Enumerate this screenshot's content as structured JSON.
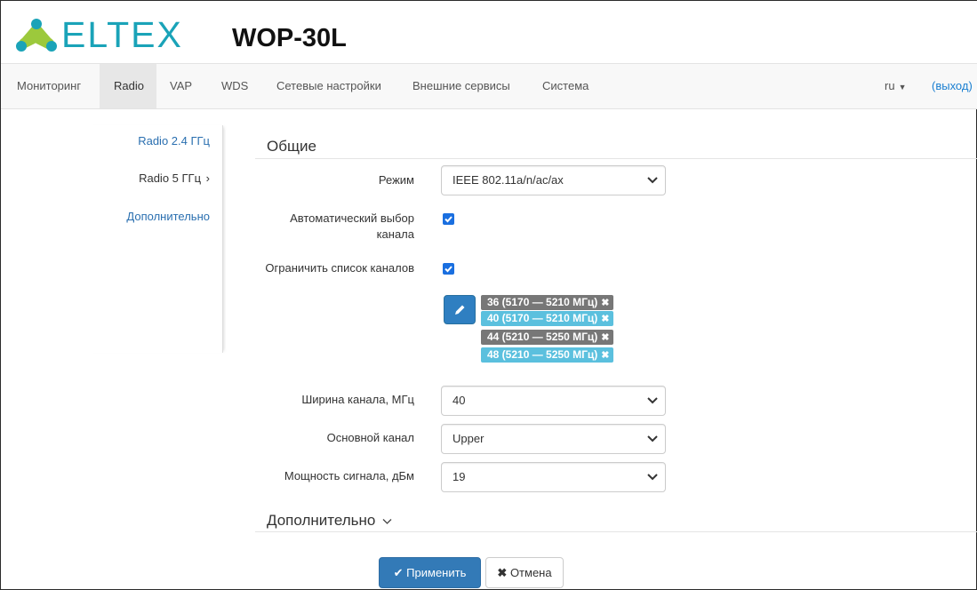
{
  "header": {
    "logo_text": "ELTEX",
    "model": "WOP-30L",
    "colors": {
      "logo": "#1aa3b8",
      "accent": "#337ab7"
    }
  },
  "nav": {
    "items": [
      {
        "label": "Мониторинг"
      },
      {
        "label": "Radio",
        "active": true
      },
      {
        "label": "VAP"
      },
      {
        "label": "WDS"
      },
      {
        "label": "Сетевые настройки"
      },
      {
        "label": "Внешние сервисы"
      },
      {
        "label": "Система"
      }
    ],
    "lang": "ru",
    "logout": "(выход)"
  },
  "sidebar": {
    "items": [
      {
        "label": "Radio 2.4 ГГц"
      },
      {
        "label": "Radio 5 ГГц",
        "active": true,
        "icon": "chevron-right-icon"
      },
      {
        "label": "Дополнительно"
      }
    ]
  },
  "general": {
    "title": "Общие",
    "mode": {
      "label": "Режим",
      "value": "IEEE 802.11a/n/ac/ax"
    },
    "auto_channel": {
      "label_line1": "Автоматический выбор",
      "label_line2": "канала",
      "checked": true
    },
    "limit_channels": {
      "label": "Ограничить список каналов",
      "checked": true
    },
    "channels": [
      {
        "label": "36 (5170 — 5210 МГц)",
        "color": "#777777"
      },
      {
        "label": "40 (5170 — 5210 МГц)",
        "color": "#5bc0de"
      },
      {
        "label": "44 (5210 — 5250 МГц)",
        "color": "#777777"
      },
      {
        "label": "48 (5210 — 5250 МГц)",
        "color": "#5bc0de"
      }
    ],
    "channel_width": {
      "label": "Ширина канала, МГц",
      "value": "40"
    },
    "primary_channel": {
      "label": "Основной канал",
      "value": "Upper"
    },
    "tx_power": {
      "label": "Мощность сигнала, дБм",
      "value": "19"
    }
  },
  "advanced": {
    "title": "Дополнительно"
  },
  "actions": {
    "apply": "Применить",
    "cancel": "Отмена"
  }
}
